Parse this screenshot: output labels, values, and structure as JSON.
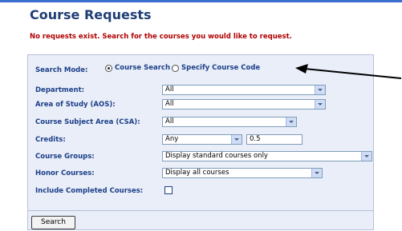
{
  "page": {
    "title": "Course Requests",
    "message": "No requests exist. Search for the courses you would like to request."
  },
  "search_form": {
    "mode_label": "Search Mode:",
    "mode_options": [
      "Course Search",
      "Specify Course Code"
    ],
    "mode_selected": "Course Search",
    "department_label": "Department:",
    "department_value": "All",
    "aos_label": "Area of Study (AOS):",
    "aos_value": "All",
    "csa_label": "Course Subject Area (CSA):",
    "csa_value": "All",
    "credits_label": "Credits:",
    "credits_operator": "Any",
    "credits_value": "0.5",
    "groups_label": "Course Groups:",
    "groups_value": "Display standard courses only",
    "honor_label": "Honor Courses:",
    "honor_value": "Display all courses",
    "completed_label": "Include Completed Courses:",
    "completed_checked": false,
    "search_button": "Search"
  },
  "colors": {
    "title": "#1f3e73",
    "message": "#b00000",
    "label": "#1c3f88",
    "panel": "#e9eef8",
    "panel_border": "#b6c1d8"
  },
  "icons": {
    "annotation_arrow": "arrow-left-icon",
    "dropdown": "chevron-down-icon"
  }
}
